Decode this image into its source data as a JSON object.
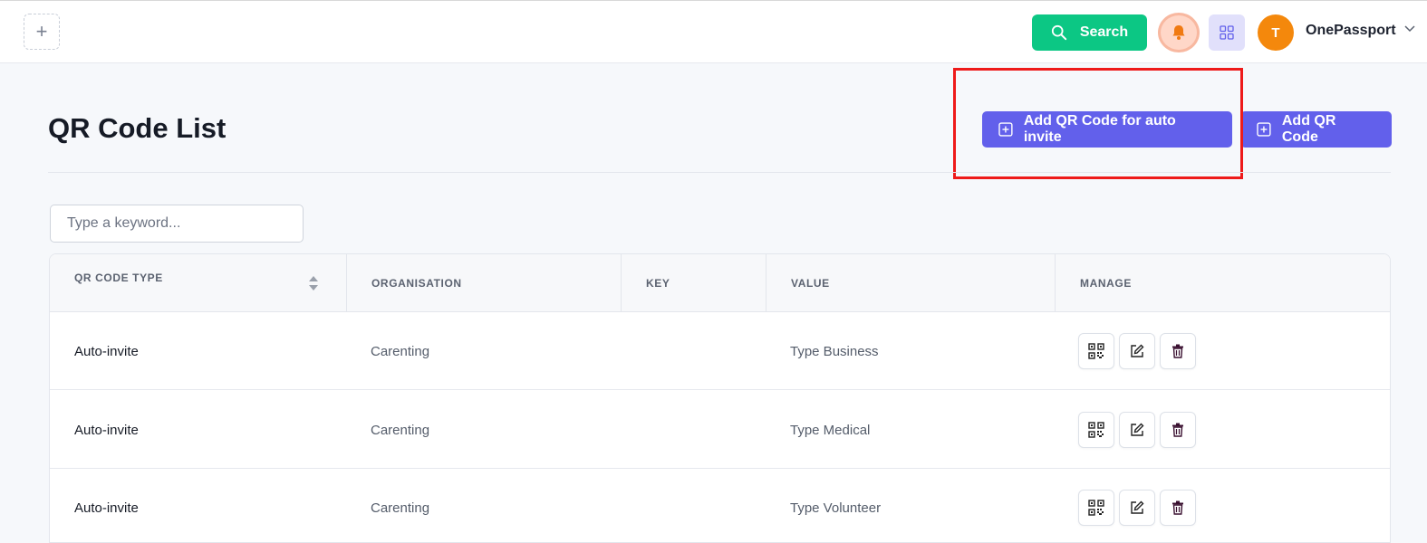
{
  "header": {
    "search_label": "Search",
    "avatar_initial": "T",
    "user_name": "OnePassport"
  },
  "page": {
    "title": "QR Code List",
    "btn_auto_invite": "Add QR Code for auto invite",
    "btn_add": "Add QR Code"
  },
  "filter": {
    "placeholder": "Type a keyword..."
  },
  "table": {
    "columns": [
      "QR CODE TYPE",
      "ORGANISATION",
      "KEY",
      "VALUE",
      "MANAGE"
    ],
    "rows": [
      {
        "type": "Auto-invite",
        "organisation": "Carenting",
        "key": "",
        "value": "Type Business"
      },
      {
        "type": "Auto-invite",
        "organisation": "Carenting",
        "key": "",
        "value": "Type Medical"
      },
      {
        "type": "Auto-invite",
        "organisation": "Carenting",
        "key": "",
        "value": "Type Volunteer"
      }
    ]
  },
  "colors": {
    "accent": "#6260eb",
    "search_green": "#0cc784",
    "avatar_orange": "#f4880c",
    "highlight_red": "#ee1a1a"
  },
  "icons": [
    "plus-icon",
    "search-icon",
    "bell-icon",
    "grid-icon",
    "chevron-down-icon",
    "plus-square-icon",
    "sort-icon",
    "qr-code-icon",
    "edit-icon",
    "trash-icon"
  ]
}
